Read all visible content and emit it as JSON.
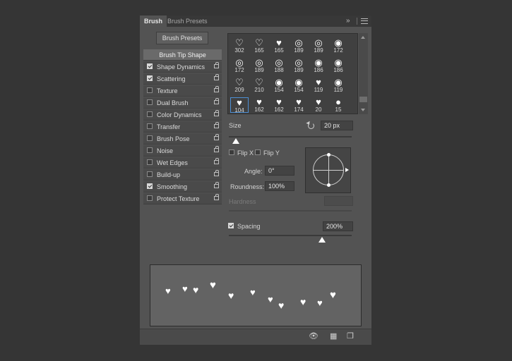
{
  "tabs": {
    "brush": "Brush",
    "presets": "Brush Presets",
    "collapse": "»"
  },
  "presets_button": "Brush Presets",
  "settings": [
    {
      "label": "Brush Tip Shape",
      "header": true
    },
    {
      "label": "Shape Dynamics",
      "checked": true
    },
    {
      "label": "Scattering",
      "checked": true
    },
    {
      "label": "Texture",
      "checked": false
    },
    {
      "label": "Dual Brush",
      "checked": false
    },
    {
      "label": "Color Dynamics",
      "checked": false
    },
    {
      "label": "Transfer",
      "checked": false
    },
    {
      "label": "Brush Pose",
      "checked": false
    },
    {
      "label": "Noise",
      "checked": false
    },
    {
      "label": "Wet Edges",
      "checked": false
    },
    {
      "label": "Build-up",
      "checked": false
    },
    {
      "label": "Smoothing",
      "checked": true
    },
    {
      "label": "Protect Texture",
      "checked": false
    }
  ],
  "brush_tips": [
    {
      "size": "302",
      "glyph": "♡"
    },
    {
      "size": "165",
      "glyph": "♡"
    },
    {
      "size": "165",
      "glyph": "♥"
    },
    {
      "size": "189",
      "glyph": "◎"
    },
    {
      "size": "189",
      "glyph": "◎"
    },
    {
      "size": "172",
      "glyph": "◉"
    },
    {
      "size": "172",
      "glyph": "◎"
    },
    {
      "size": "189",
      "glyph": "◎"
    },
    {
      "size": "188",
      "glyph": "◎"
    },
    {
      "size": "189",
      "glyph": "◎"
    },
    {
      "size": "186",
      "glyph": "◉"
    },
    {
      "size": "186",
      "glyph": "◉"
    },
    {
      "size": "209",
      "glyph": "♡"
    },
    {
      "size": "210",
      "glyph": "♡"
    },
    {
      "size": "154",
      "glyph": "◉"
    },
    {
      "size": "154",
      "glyph": "◉"
    },
    {
      "size": "119",
      "glyph": "♥"
    },
    {
      "size": "119",
      "glyph": "◉"
    },
    {
      "size": "104",
      "glyph": "♥",
      "selected": true
    },
    {
      "size": "162",
      "glyph": "♥"
    },
    {
      "size": "162",
      "glyph": "♥"
    },
    {
      "size": "174",
      "glyph": "♥"
    },
    {
      "size": "20",
      "glyph": "♥"
    },
    {
      "size": "15",
      "glyph": "●"
    }
  ],
  "size": {
    "label": "Size",
    "value": "20 px",
    "level": 0.06
  },
  "flip_x": {
    "label": "Flip X",
    "checked": false
  },
  "flip_y": {
    "label": "Flip Y",
    "checked": false
  },
  "angle": {
    "label": "Angle:",
    "value": "0°"
  },
  "roundness": {
    "label": "Roundness:",
    "value": "100%"
  },
  "hardness": {
    "label": "Hardness",
    "value": ""
  },
  "spacing": {
    "label": "Spacing",
    "value": "200%",
    "checked": true,
    "level": 0.76
  },
  "bottom_icons": [
    "visibility-toggle-icon",
    "brush-grid-icon",
    "new-preset-icon"
  ]
}
